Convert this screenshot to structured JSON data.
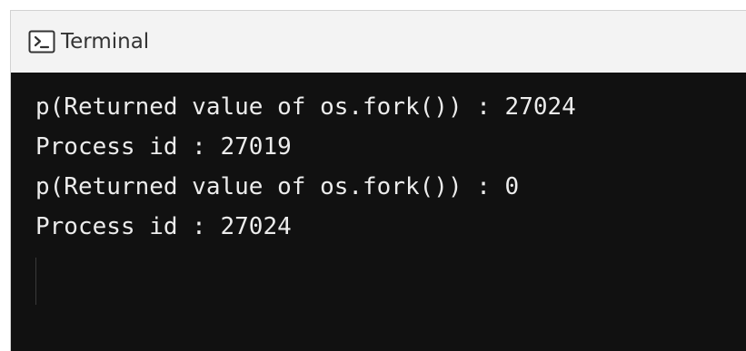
{
  "tab": {
    "title": "Terminal",
    "icon": "terminal-icon"
  },
  "terminal": {
    "lines": [
      "p(Returned value of os.fork()) : 27024",
      "Process id : 27019",
      "p(Returned value of os.fork()) : 0",
      "Process id : 27024"
    ]
  },
  "colors": {
    "background": "#111111",
    "text": "#ececec",
    "titlebar": "#f3f3f3"
  }
}
